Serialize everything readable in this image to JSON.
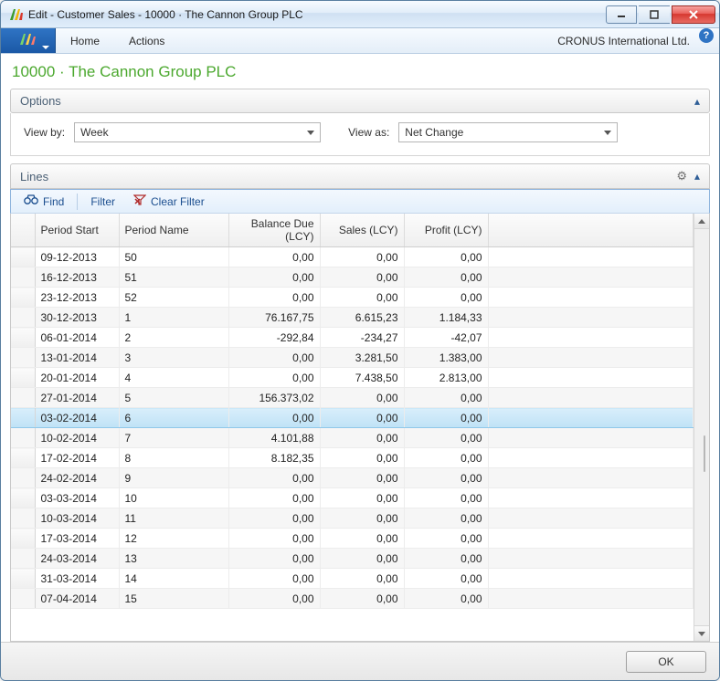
{
  "window": {
    "title": "Edit - Customer Sales - 10000 · The Cannon Group PLC"
  },
  "ribbon": {
    "tabs": {
      "home": "Home",
      "actions": "Actions"
    },
    "company": "CRONUS International Ltd."
  },
  "heading": "10000 · The Cannon Group PLC",
  "options": {
    "title": "Options",
    "view_by": {
      "label": "View by:",
      "value": "Week"
    },
    "view_as": {
      "label": "View as:",
      "value": "Net Change"
    }
  },
  "lines": {
    "title": "Lines",
    "toolbar": {
      "find": "Find",
      "filter": "Filter",
      "clear_filter": "Clear Filter"
    },
    "columns": {
      "period_start": "Period Start",
      "period_name": "Period Name",
      "balance_due": "Balance Due (LCY)",
      "sales": "Sales (LCY)",
      "profit": "Profit (LCY)"
    },
    "selected_index": 8,
    "rows": [
      {
        "period_start": "09-12-2013",
        "period_name": "50",
        "balance_due": "0,00",
        "sales": "0,00",
        "profit": "0,00"
      },
      {
        "period_start": "16-12-2013",
        "period_name": "51",
        "balance_due": "0,00",
        "sales": "0,00",
        "profit": "0,00"
      },
      {
        "period_start": "23-12-2013",
        "period_name": "52",
        "balance_due": "0,00",
        "sales": "0,00",
        "profit": "0,00"
      },
      {
        "period_start": "30-12-2013",
        "period_name": "1",
        "balance_due": "76.167,75",
        "sales": "6.615,23",
        "profit": "1.184,33"
      },
      {
        "period_start": "06-01-2014",
        "period_name": "2",
        "balance_due": "-292,84",
        "sales": "-234,27",
        "profit": "-42,07"
      },
      {
        "period_start": "13-01-2014",
        "period_name": "3",
        "balance_due": "0,00",
        "sales": "3.281,50",
        "profit": "1.383,00"
      },
      {
        "period_start": "20-01-2014",
        "period_name": "4",
        "balance_due": "0,00",
        "sales": "7.438,50",
        "profit": "2.813,00"
      },
      {
        "period_start": "27-01-2014",
        "period_name": "5",
        "balance_due": "156.373,02",
        "sales": "0,00",
        "profit": "0,00"
      },
      {
        "period_start": "03-02-2014",
        "period_name": "6",
        "balance_due": "0,00",
        "sales": "0,00",
        "profit": "0,00"
      },
      {
        "period_start": "10-02-2014",
        "period_name": "7",
        "balance_due": "4.101,88",
        "sales": "0,00",
        "profit": "0,00"
      },
      {
        "period_start": "17-02-2014",
        "period_name": "8",
        "balance_due": "8.182,35",
        "sales": "0,00",
        "profit": "0,00"
      },
      {
        "period_start": "24-02-2014",
        "period_name": "9",
        "balance_due": "0,00",
        "sales": "0,00",
        "profit": "0,00"
      },
      {
        "period_start": "03-03-2014",
        "period_name": "10",
        "balance_due": "0,00",
        "sales": "0,00",
        "profit": "0,00"
      },
      {
        "period_start": "10-03-2014",
        "period_name": "11",
        "balance_due": "0,00",
        "sales": "0,00",
        "profit": "0,00"
      },
      {
        "period_start": "17-03-2014",
        "period_name": "12",
        "balance_due": "0,00",
        "sales": "0,00",
        "profit": "0,00"
      },
      {
        "period_start": "24-03-2014",
        "period_name": "13",
        "balance_due": "0,00",
        "sales": "0,00",
        "profit": "0,00"
      },
      {
        "period_start": "31-03-2014",
        "period_name": "14",
        "balance_due": "0,00",
        "sales": "0,00",
        "profit": "0,00"
      },
      {
        "period_start": "07-04-2014",
        "period_name": "15",
        "balance_due": "0,00",
        "sales": "0,00",
        "profit": "0,00"
      }
    ]
  },
  "footer": {
    "ok": "OK"
  }
}
